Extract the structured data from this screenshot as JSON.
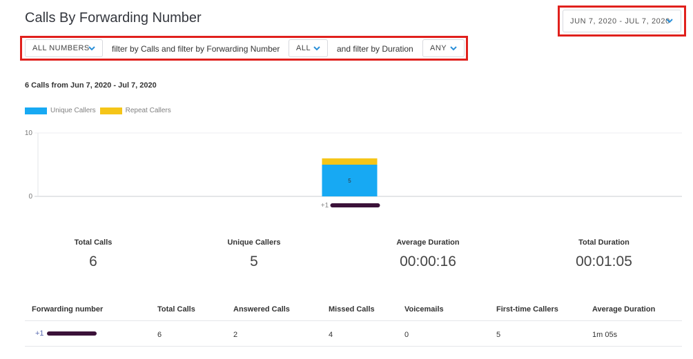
{
  "header": {
    "title": "Calls By Forwarding Number",
    "date_range": "JUN 7, 2020 - JUL 7, 2020"
  },
  "filters": {
    "numbers_select": "ALL NUMBERS",
    "text1": "filter by Calls and filter by Forwarding Number",
    "forwarding_select": "ALL",
    "text2": "and filter by Duration",
    "duration_select": "ANY"
  },
  "summary": "6 Calls from Jun 7, 2020 - Jul 7, 2020",
  "colors": {
    "unique": "#17a9f3",
    "repeat": "#f5c518",
    "highlight": "#e0201c"
  },
  "chart_data": {
    "type": "bar",
    "stacked": true,
    "categories": [
      "+1"
    ],
    "series": [
      {
        "name": "Unique Callers",
        "values": [
          5
        ],
        "color": "#17a9f3"
      },
      {
        "name": "Repeat Callers",
        "values": [
          1
        ],
        "color": "#f5c518"
      }
    ],
    "ylim": [
      0,
      10
    ],
    "yticks": [
      0,
      10
    ],
    "data_labels": [
      "5"
    ],
    "grid": true,
    "legend": "top-left"
  },
  "stats": [
    {
      "label": "Total Calls",
      "value": "6"
    },
    {
      "label": "Unique Callers",
      "value": "5"
    },
    {
      "label": "Average Duration",
      "value": "00:00:16"
    },
    {
      "label": "Total Duration",
      "value": "00:01:05"
    }
  ],
  "table": {
    "headers": [
      "Forwarding number",
      "Total Calls",
      "Answered Calls",
      "Missed Calls",
      "Voicemails",
      "First-time Callers",
      "Average Duration"
    ],
    "rows": [
      [
        "+1",
        "6",
        "2",
        "4",
        "0",
        "5",
        "1m 05s"
      ]
    ]
  },
  "icons": {
    "dropdown": "chevron-down-icon"
  }
}
